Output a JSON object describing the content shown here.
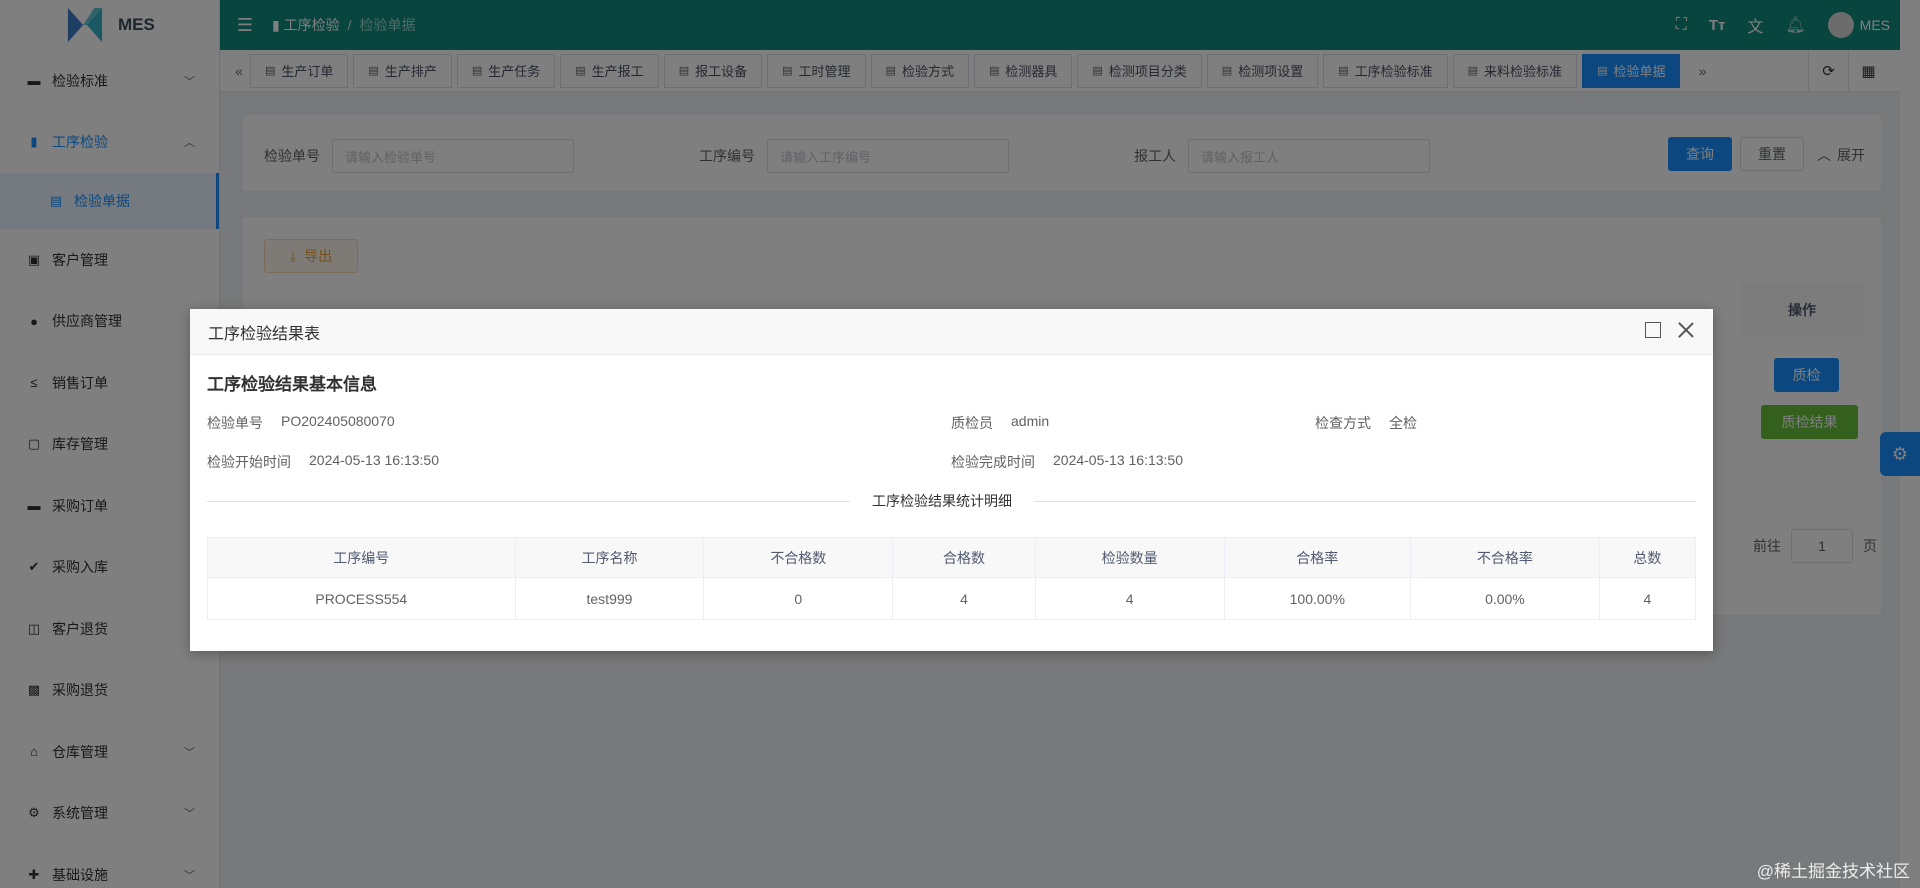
{
  "app": {
    "name": "MES"
  },
  "sidebar": {
    "items": [
      {
        "label": "检验标准",
        "icon": "monitor-icon",
        "arrow": "chevron-down"
      },
      {
        "label": "工序检验",
        "icon": "book-icon",
        "arrow": "chevron-up",
        "active": true
      },
      {
        "label": "检验单据",
        "icon": "document-icon",
        "sub": true
      },
      {
        "label": "客户管理",
        "icon": "contacts-icon"
      },
      {
        "label": "供应商管理",
        "icon": "user-icon"
      },
      {
        "label": "销售订单",
        "icon": "sale-icon"
      },
      {
        "label": "库存管理",
        "icon": "box-icon"
      },
      {
        "label": "采购订单",
        "icon": "briefcase-icon"
      },
      {
        "label": "采购入库",
        "icon": "double-check-icon"
      },
      {
        "label": "客户退货",
        "icon": "inbox-icon"
      },
      {
        "label": "采购退货",
        "icon": "ticket-icon"
      },
      {
        "label": "仓库管理",
        "icon": "warehouse-icon",
        "arrow": "chevron-down"
      },
      {
        "label": "系统管理",
        "icon": "gear-icon",
        "arrow": "chevron-down"
      },
      {
        "label": "基础设施",
        "icon": "tools-icon",
        "arrow": "chevron-down"
      }
    ]
  },
  "navbar": {
    "breadcrumb_parent": "工序检验",
    "breadcrumb_sep": "/",
    "breadcrumb_current": "检验单据",
    "user": "MES"
  },
  "tags": [
    {
      "label": "生产订单"
    },
    {
      "label": "生产排产"
    },
    {
      "label": "生产任务"
    },
    {
      "label": "生产报工"
    },
    {
      "label": "报工设备"
    },
    {
      "label": "工时管理"
    },
    {
      "label": "检验方式"
    },
    {
      "label": "检测器具"
    },
    {
      "label": "检测项目分类"
    },
    {
      "label": "检测项设置"
    },
    {
      "label": "工序检验标准"
    },
    {
      "label": "来料检验标准"
    },
    {
      "label": "检验单据",
      "active": true
    }
  ],
  "search": {
    "field1_label": "检验单号",
    "field1_placeholder": "请输入检验单号",
    "field2_label": "工序编号",
    "field2_placeholder": "请输入工序编号",
    "field3_label": "报工人",
    "field3_placeholder": "请输入报工人",
    "query": "查询",
    "reset": "重置",
    "expand": "展开"
  },
  "table": {
    "export": "导出",
    "op_header": "操作",
    "btn_inspect": "质检",
    "btn_result": "质检结果",
    "pager_goto": "前往",
    "pager_page": "1",
    "pager_suffix": "页"
  },
  "dialog": {
    "title": "工序检验结果表",
    "section_title": "工序检验结果基本信息",
    "order_no_label": "检验单号",
    "order_no": "PO202405080070",
    "inspector_label": "质检员",
    "inspector": "admin",
    "method_label": "检查方式",
    "method": "全检",
    "start_label": "检验开始时间",
    "start": "2024-05-13 16:13:50",
    "end_label": "检验完成时间",
    "end": "2024-05-13 16:13:50",
    "divider_text": "工序检验结果统计明细",
    "columns": [
      "工序编号",
      "工序名称",
      "不合格数",
      "合格数",
      "检验数量",
      "合格率",
      "不合格率",
      "总数"
    ],
    "rows": [
      [
        "PROCESS554",
        "test999",
        "0",
        "4",
        "4",
        "100.00%",
        "0.00%",
        "4"
      ]
    ]
  },
  "watermark": "@稀土掘金技术社区",
  "colors": {
    "header": "#0f8a7d",
    "primary": "#1890ff",
    "success": "#67c23a",
    "warning": "#e6a23c"
  }
}
